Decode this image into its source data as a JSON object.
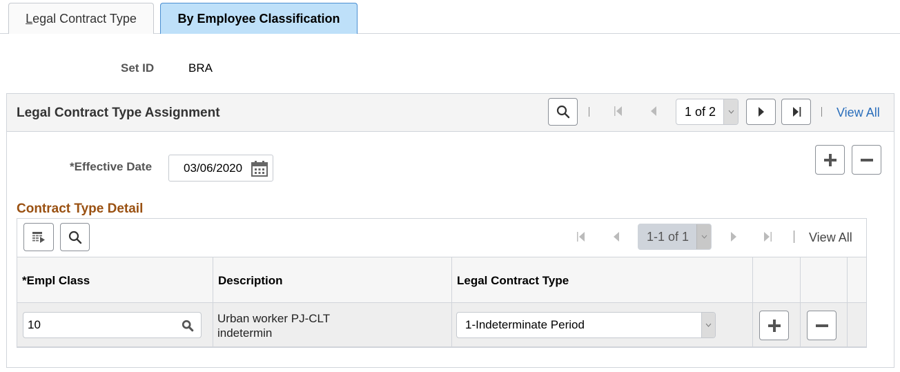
{
  "tabs": [
    {
      "label_accesskey": "L",
      "label_rest": "egal Contract Type",
      "active": false
    },
    {
      "label": "By Employee Classification",
      "active": true
    }
  ],
  "setid": {
    "label": "Set ID",
    "value": "BRA"
  },
  "assignment": {
    "title": "Legal Contract Type Assignment",
    "pager": {
      "value": "1 of 2",
      "view_all": "View All"
    },
    "effective_date": {
      "label": "*Effective Date",
      "value": "03/06/2020"
    }
  },
  "detail": {
    "title": "Contract Type Detail",
    "pager": {
      "value": "1-1 of 1",
      "view_all": "View All"
    },
    "columns": [
      "*Empl Class",
      "Description",
      "Legal Contract Type"
    ],
    "rows": [
      {
        "empl_class": "10",
        "description_line1": "Urban worker PJ-CLT",
        "description_line2": "indetermin",
        "legal_contract_type": "1-Indeterminate Period"
      }
    ]
  },
  "icons": {
    "search": "search-icon",
    "first": "first-page-icon",
    "prev": "previous-icon",
    "next": "next-icon",
    "last": "last-page-icon",
    "calendar": "calendar-icon",
    "add": "plus-icon",
    "remove": "minus-icon",
    "personalize": "grid-personalize-icon"
  },
  "colors": {
    "active_tab": "#bee0f9",
    "link": "#2a6ebb",
    "section_title": "#9a5112"
  }
}
